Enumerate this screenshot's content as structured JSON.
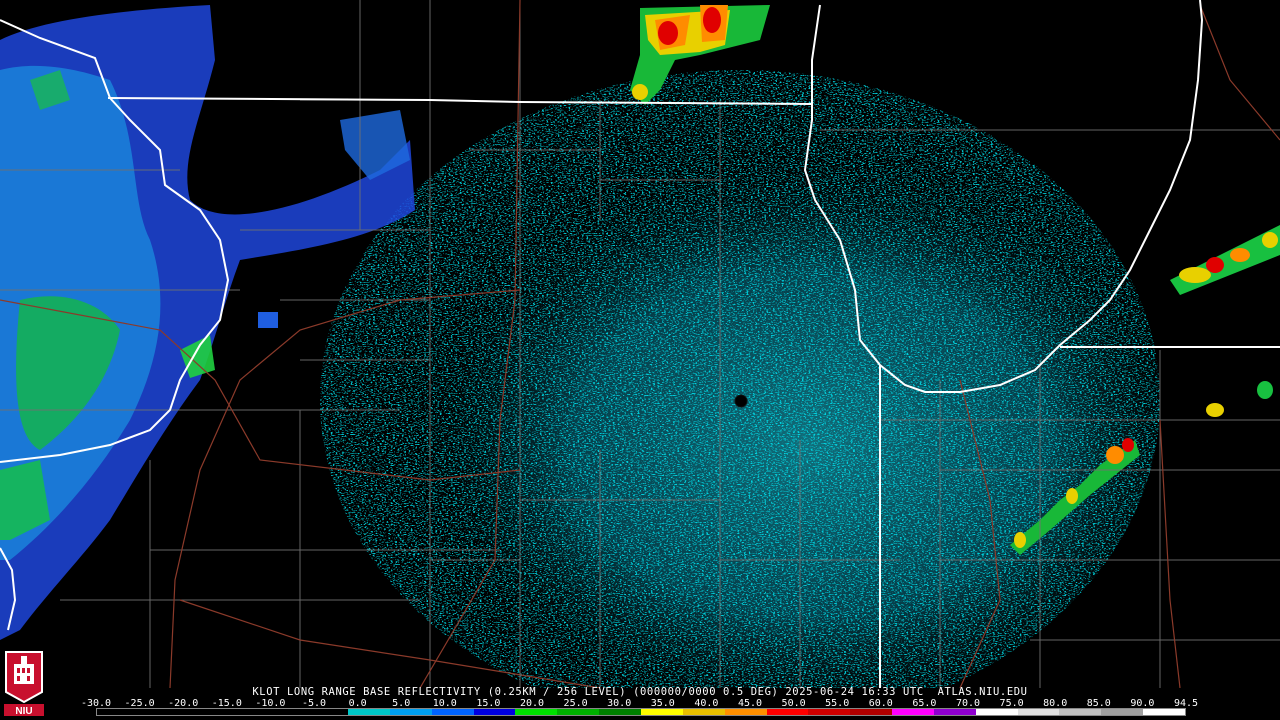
{
  "product": {
    "caption": "KLOT LONG RANGE BASE REFLECTIVITY (0.25KM / 256 LEVEL) (000000/0000 0.5 DEG) 2025-06-24 16:33 UTC  ATLAS.NIU.EDU",
    "logo_text": "NIU"
  },
  "legend": {
    "ticks": [
      "-30.0",
      "-25.0",
      "-20.0",
      "-15.0",
      "-10.0",
      "-5.0",
      "0.0",
      "5.0",
      "10.0",
      "15.0",
      "20.0",
      "25.0",
      "30.0",
      "35.0",
      "40.0",
      "45.0",
      "50.0",
      "55.0",
      "60.0",
      "65.0",
      "70.0",
      "75.0",
      "80.0",
      "85.0",
      "90.0",
      "94.5"
    ],
    "colors": [
      "#000000",
      "#000000",
      "#000000",
      "#000000",
      "#000000",
      "#000000",
      "#00c8c8",
      "#00a0f0",
      "#0064ff",
      "#0000e0",
      "#00e000",
      "#00b000",
      "#008000",
      "#ffff00",
      "#e8c000",
      "#ff9000",
      "#ff0000",
      "#d00000",
      "#b00000",
      "#ff00ff",
      "#9000d0",
      "#ffffff",
      "#e0e0e0",
      "#c0c0c0",
      "#a0a0a0",
      "#ffffff"
    ]
  },
  "map": {
    "state_border_color": "#ffffff",
    "county_border_color": "#707070",
    "highway_color": "#8b3a2a",
    "radar_site": "KLOT"
  }
}
